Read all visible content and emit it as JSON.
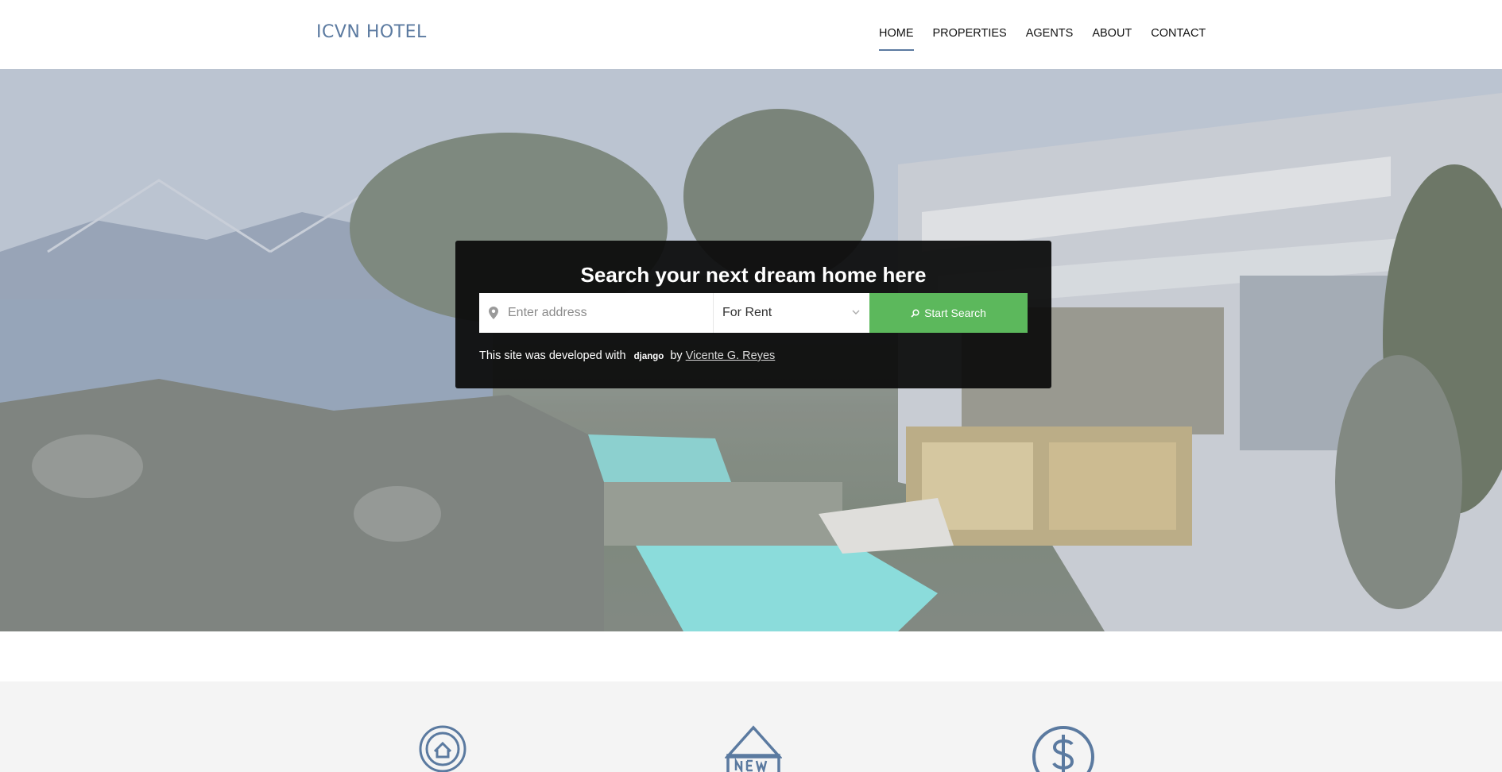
{
  "brand": {
    "name": "ICVN HOTEL"
  },
  "nav": {
    "items": [
      {
        "label": "HOME",
        "active": true
      },
      {
        "label": "PROPERTIES",
        "active": false
      },
      {
        "label": "AGENTS",
        "active": false
      },
      {
        "label": "ABOUT",
        "active": false
      },
      {
        "label": "CONTACT",
        "active": false
      }
    ]
  },
  "search": {
    "title": "Search your next dream home here",
    "address_placeholder": "Enter address",
    "address_value": "",
    "type_selected": "For Rent",
    "button_label": "Start Search"
  },
  "credit": {
    "prefix": "This site was developed with",
    "framework": "django",
    "by": "by",
    "author": "Vicente G. Reyes"
  },
  "carousel": {
    "slides": 3,
    "active_index": 2
  },
  "features": {
    "icons": [
      "award-house-icon",
      "new-tag-icon",
      "dollar-icon"
    ]
  },
  "colors": {
    "accent": "#5b7aa0",
    "button": "#5cb85c",
    "overlay": "#0a0a0a"
  }
}
